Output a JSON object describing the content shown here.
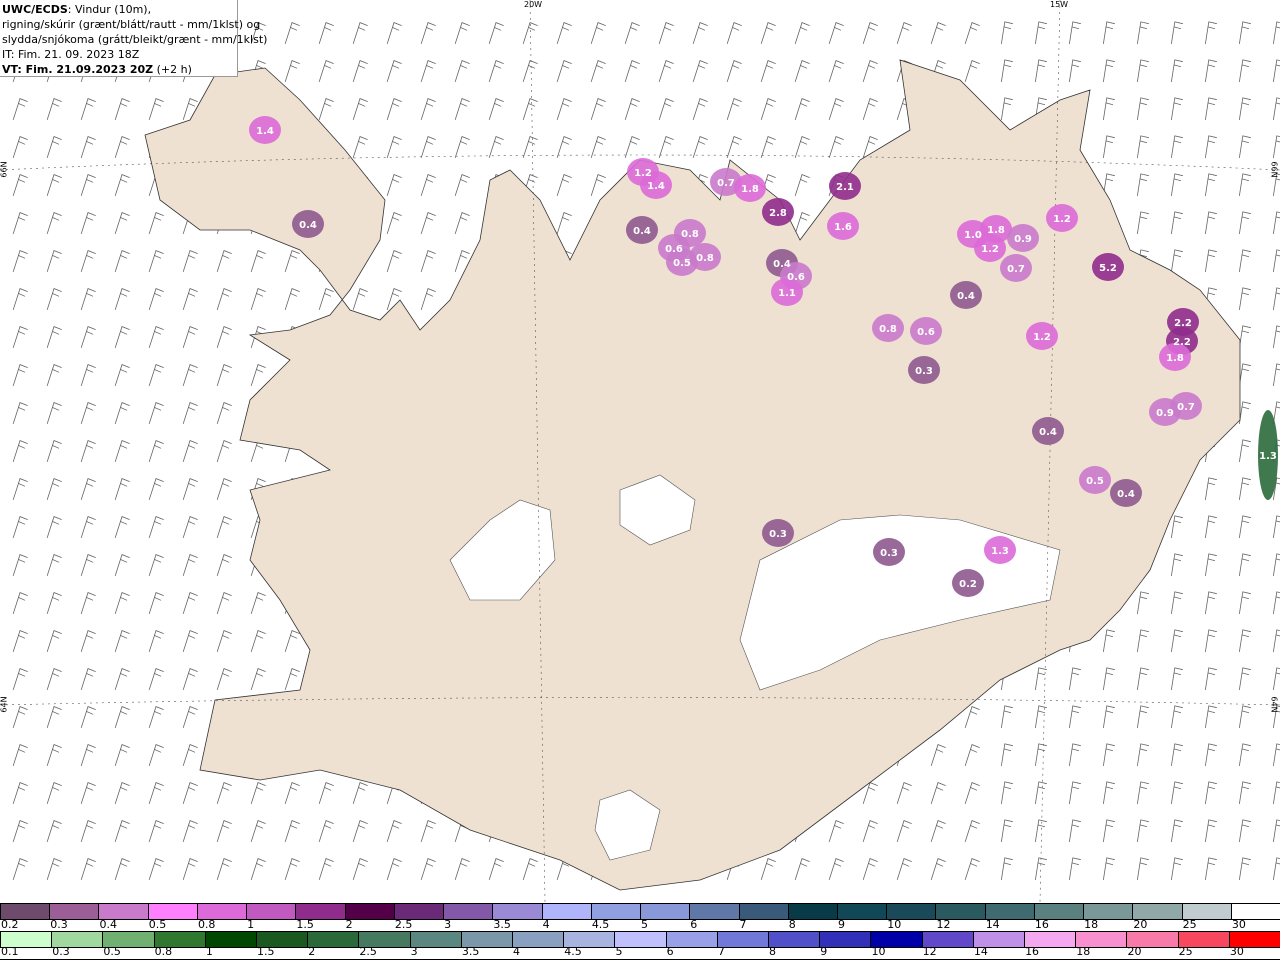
{
  "header": {
    "source": "UWC/ECDS",
    "line1_rest": ": Vindur (10m),",
    "line2": "rigning/skúrir (grænt/blátt/rautt - mm/1klst) og",
    "line3": "slydda/snjókoma (grátt/bleikt/grænt - mm/1klst)",
    "issue_time": "IT: Fim. 21. 09. 2023 18Z",
    "valid_time": "VT: Fim. 21.09.2023 20Z",
    "lead": " (+2 h)"
  },
  "grid_labels": {
    "lon_20": "20W",
    "lon_15": "15W",
    "lat_66_left": "66N",
    "lat_66_right": "66N",
    "lat_64_left": "64N",
    "lat_64_right": "64N"
  },
  "colors": {
    "land": "#efe1d1",
    "sea": "#ffffff",
    "roads": "#e8663a",
    "glacier": "#ffffff"
  },
  "precip_labels": [
    "1.4",
    "0.4",
    "1.2",
    "1.4",
    "0.4",
    "0.8",
    "0.6",
    "0.5",
    "0.8",
    "0.7",
    "1.8",
    "2.8",
    "2.1",
    "1.6",
    "0.4",
    "0.6",
    "1.1",
    "1.0",
    "1.8",
    "1.2",
    "0.9",
    "0.7",
    "1.2",
    "5.2",
    "0.8",
    "0.6",
    "0.3",
    "0.4",
    "1.2",
    "2.2",
    "2.2",
    "1.8",
    "0.9",
    "0.7",
    "0.4",
    "0.5",
    "0.4",
    "0.3",
    "0.3",
    "0.2",
    "1.3",
    "1.3"
  ],
  "legend_snow": {
    "labels": [
      "0.2",
      "0.3",
      "0.4",
      "0.5",
      "0.8",
      "1",
      "1.5",
      "2",
      "2.5",
      "3",
      "3.5",
      "4",
      "4.5",
      "5",
      "6",
      "7",
      "8",
      "9",
      "10",
      "12",
      "14",
      "16",
      "18",
      "20",
      "25",
      "30"
    ],
    "colors": [
      "#6e4a6c",
      "#9b5e97",
      "#c97acb",
      "#ff80ff",
      "#dc6ad8",
      "#c05ac0",
      "#8f2c8c",
      "#540048",
      "#6a2a78",
      "#8458a8",
      "#9a8ad6",
      "#b0b4fa",
      "#90a0e0",
      "#8898d8",
      "#6078a8",
      "#3a5a7a",
      "#083a48",
      "#104858",
      "#1a4a5a",
      "#2a5a60",
      "#3e6a70",
      "#5a8080",
      "#7a9898",
      "#90a8a8",
      "#c0ccd0",
      "#ffffff"
    ]
  },
  "legend_rain": {
    "labels": [
      "0.1",
      "0.3",
      "0.5",
      "0.8",
      "1",
      "1.5",
      "2",
      "2.5",
      "3",
      "3.5",
      "4",
      "4.5",
      "5",
      "6",
      "7",
      "8",
      "9",
      "10",
      "12",
      "14",
      "16",
      "18",
      "20",
      "25",
      "30"
    ],
    "colors": [
      "#ccffcc",
      "#a0d8a0",
      "#70b070",
      "#307830",
      "#004800",
      "#1a5a20",
      "#2a6a3a",
      "#457a60",
      "#5a8880",
      "#7a98a8",
      "#8aa0c0",
      "#a8b4e0",
      "#c0c0ff",
      "#98a0e8",
      "#7078d8",
      "#5050c8",
      "#3030b8",
      "#0000a8",
      "#6048c8",
      "#c090e8",
      "#f4a8f0",
      "#f890d0",
      "#f87aa8",
      "#f84860",
      "#ff0000"
    ]
  }
}
